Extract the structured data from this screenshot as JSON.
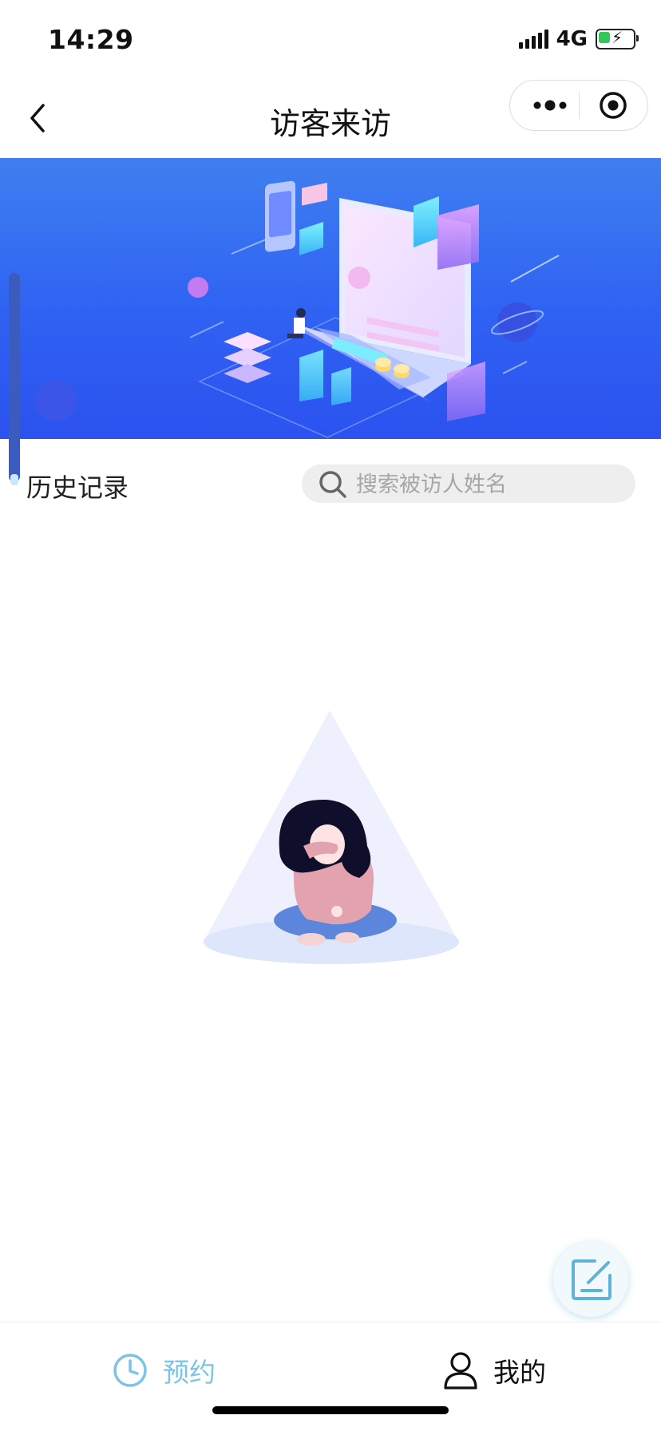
{
  "status_bar": {
    "time": "14:29",
    "network": "4G"
  },
  "nav": {
    "title": "访客来访"
  },
  "history": {
    "label": "历史记录"
  },
  "search": {
    "placeholder": "搜索被访人姓名",
    "value": ""
  },
  "tabbar": {
    "items": [
      {
        "label": "预约",
        "icon": "clock-icon",
        "active": true
      },
      {
        "label": "我的",
        "icon": "person-icon",
        "active": false
      }
    ]
  },
  "colors": {
    "active_tab": "#7cc4e4",
    "banner": "#2f62f3",
    "search_bg": "#eeeeee"
  }
}
